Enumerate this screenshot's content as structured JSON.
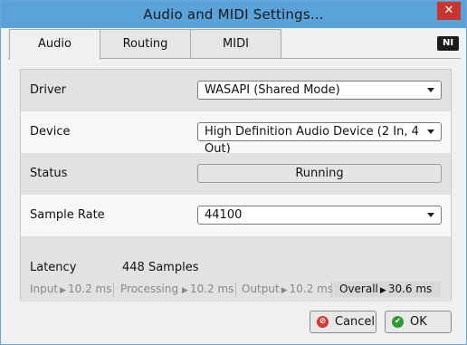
{
  "window": {
    "title": "Audio and MIDI Settings...",
    "close_glyph": "✕"
  },
  "tabs": [
    {
      "label": "Audio",
      "active": true
    },
    {
      "label": "Routing",
      "active": false
    },
    {
      "label": "MIDI",
      "active": false
    }
  ],
  "logo_text": "NI",
  "settings": {
    "driver": {
      "label": "Driver",
      "value": "WASAPI (Shared Mode)"
    },
    "device": {
      "label": "Device",
      "value": "High Definition Audio Device (2 In, 4 Out)"
    },
    "status": {
      "label": "Status",
      "value": "Running"
    },
    "sample_rate": {
      "label": "Sample Rate",
      "value": "44100"
    }
  },
  "latency": {
    "label": "Latency",
    "value": "448 Samples",
    "input": {
      "label": "Input",
      "value": "10.2 ms"
    },
    "processing": {
      "label": "Processing",
      "value": "10.2 ms"
    },
    "output": {
      "label": "Output",
      "value": "10.2 ms"
    },
    "overall": {
      "label": "Overall",
      "value": "30.6 ms"
    }
  },
  "buttons": {
    "cancel": "Cancel",
    "ok": "OK"
  },
  "icons": {
    "cancel": "cancel-icon",
    "ok": "check-icon"
  },
  "colors": {
    "titlebar": "#5aa2da",
    "close": "#c7352c",
    "cancel_icon": "#d23a2e",
    "ok_icon": "#2f9a32"
  }
}
